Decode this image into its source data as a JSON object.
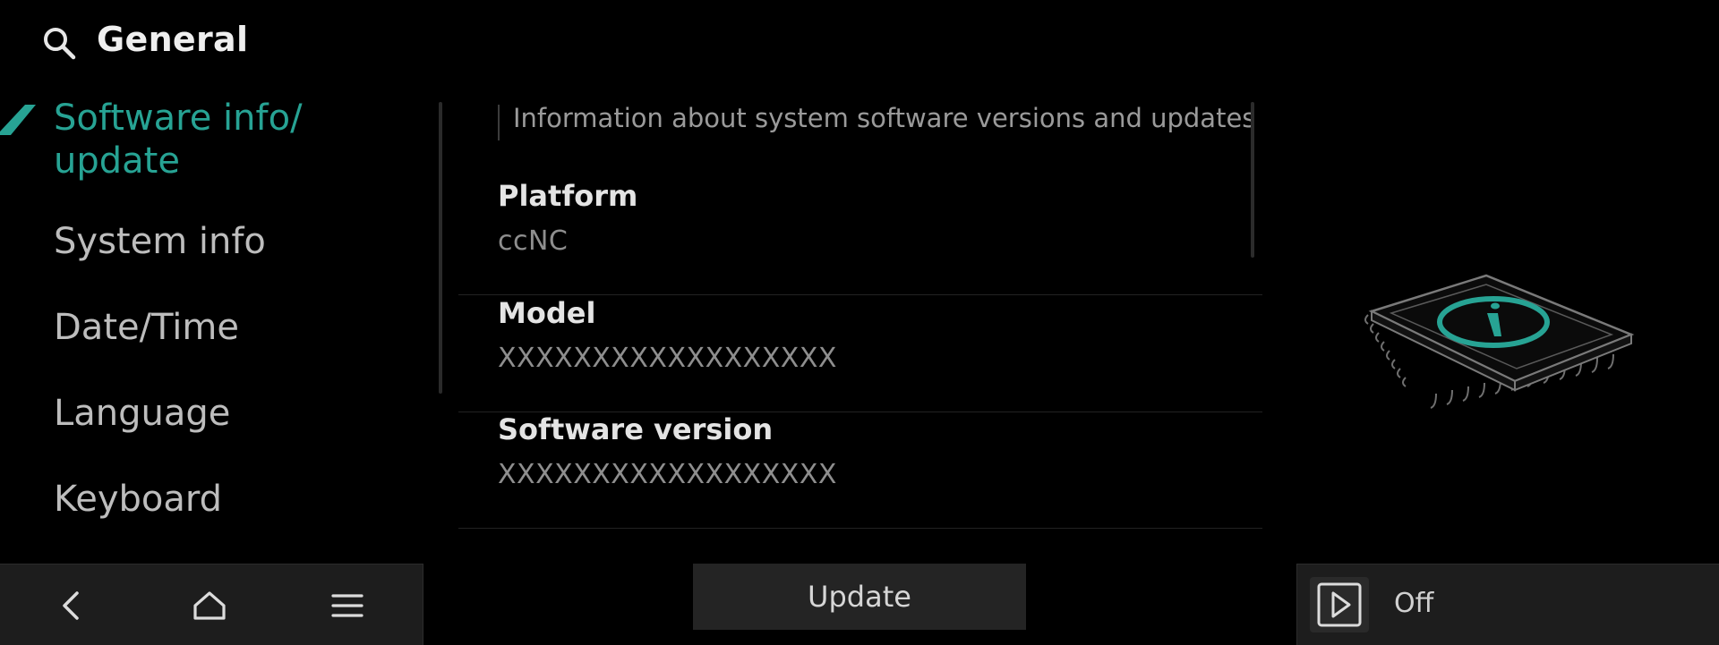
{
  "header": {
    "title": "General",
    "search_icon": "search-icon"
  },
  "sidebar": {
    "active_item": "Software info/\nupdate",
    "items": [
      {
        "label": "System info"
      },
      {
        "label": "Date/Time"
      },
      {
        "label": "Language"
      },
      {
        "label": "Keyboard"
      }
    ],
    "accent_color": "#27a394"
  },
  "content": {
    "description": "Information about system software versions and updates",
    "rows": [
      {
        "title": "Platform",
        "value": "ccNC"
      },
      {
        "title": "Model",
        "value": "XXXXXXXXXXXXXXXXXX"
      },
      {
        "title": "Software version",
        "value": "XXXXXXXXXXXXXXXXXX"
      }
    ]
  },
  "illustration": {
    "icon": "chip-info-icon"
  },
  "bottom_nav": {
    "icons": [
      "back-icon",
      "home-icon",
      "menu-icon"
    ]
  },
  "actions": {
    "update_label": "Update"
  },
  "media": {
    "status": "Off",
    "icon": "play-icon"
  }
}
